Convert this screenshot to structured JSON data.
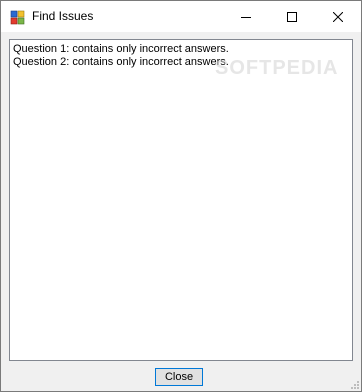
{
  "window": {
    "title": "Find Issues",
    "icon": "app-window-icon"
  },
  "titlebar_buttons": {
    "minimize": "minimize-icon",
    "maximize": "maximize-icon",
    "close": "close-icon"
  },
  "issues": [
    "Question 1: contains only incorrect answers.",
    "Question 2: contains only incorrect answers."
  ],
  "watermark": "SOFTPEDIA",
  "footer": {
    "close_label": "Close"
  },
  "colors": {
    "button_focus_border": "#0078d7",
    "window_background": "#f0f0f0",
    "text": "#000000"
  }
}
